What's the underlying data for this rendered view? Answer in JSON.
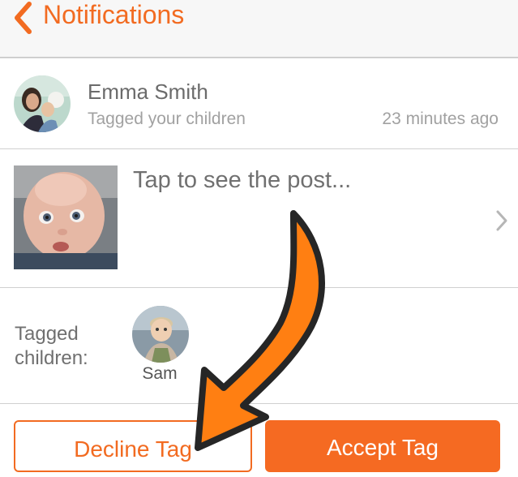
{
  "header": {
    "title": "Notifications"
  },
  "notification": {
    "user_name": "Emma Smith",
    "subtitle": "Tagged your children",
    "time": "23 minutes ago"
  },
  "post": {
    "cta": "Tap to see the post..."
  },
  "tagged": {
    "label": "Tagged children:",
    "children": [
      {
        "name": "Sam"
      }
    ]
  },
  "actions": {
    "decline_label": "Decline Tag",
    "accept_label": "Accept Tag"
  },
  "colors": {
    "accent": "#f26b21",
    "arrow_fill": "#ff7f12",
    "divider": "#d0d0d0"
  }
}
